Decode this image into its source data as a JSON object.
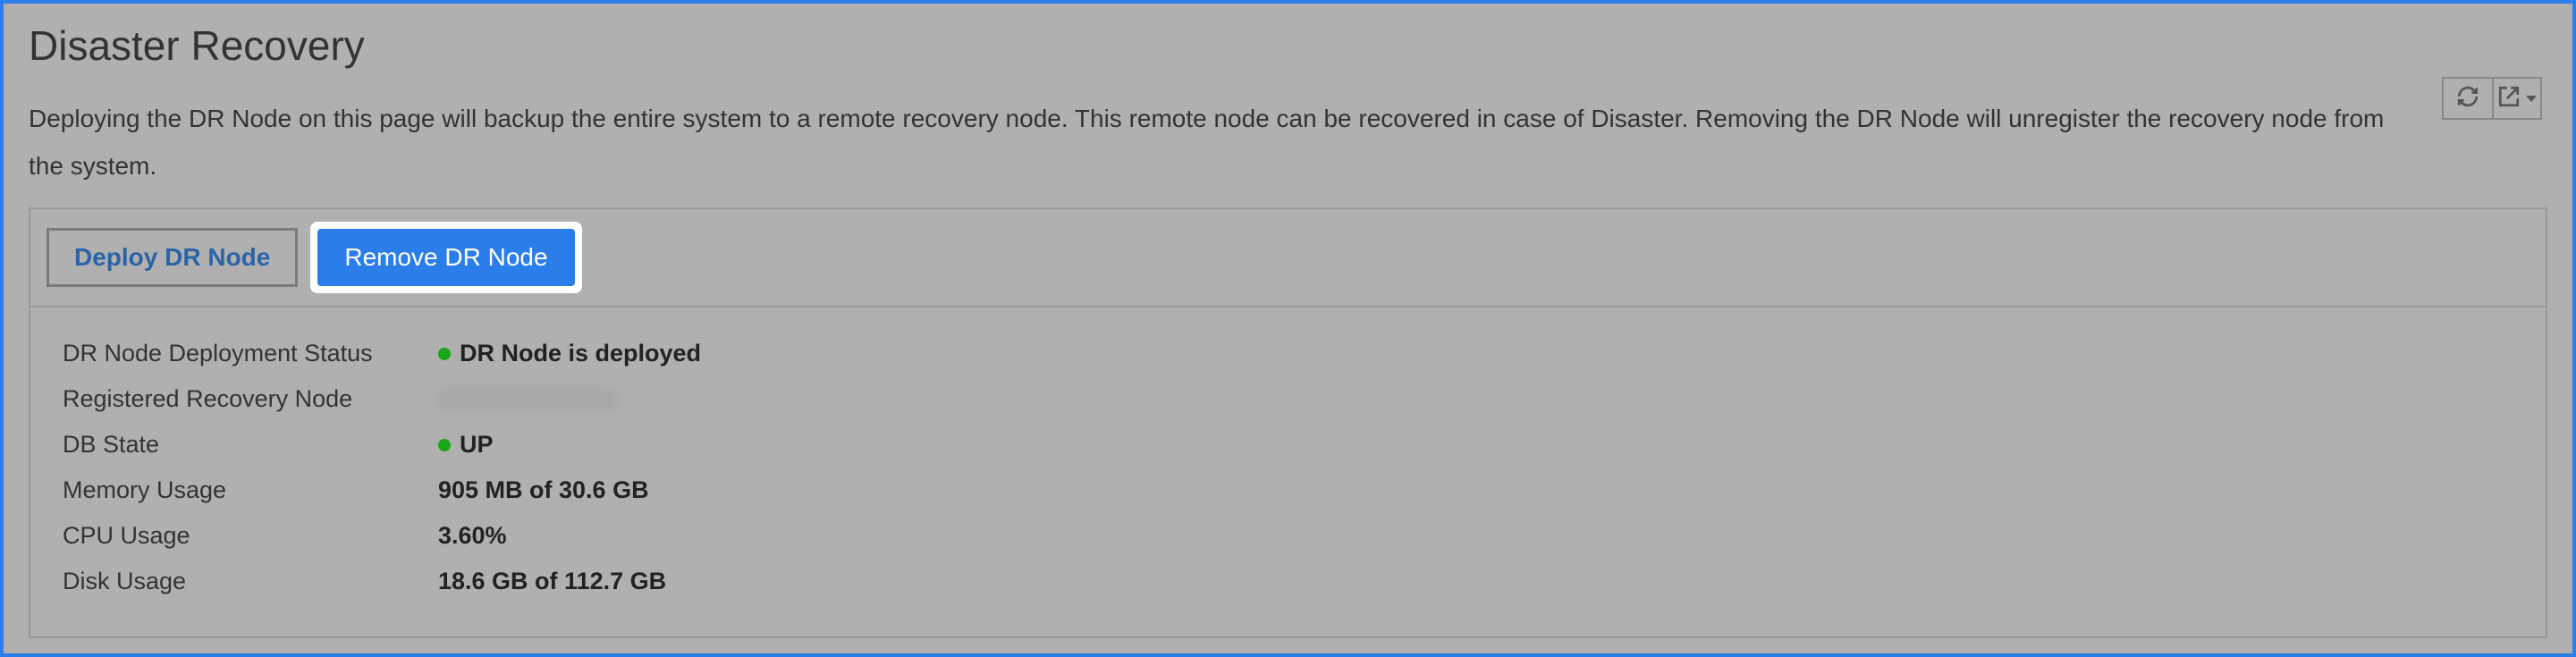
{
  "page": {
    "title": "Disaster Recovery",
    "description": "Deploying the DR Node on this page will backup the entire system to a remote recovery node. This remote node can be recovered in case of Disaster. Removing the DR Node will unregister the recovery node from the system."
  },
  "toolbar": {
    "deploy_label": "Deploy DR Node",
    "remove_label": "Remove DR Node"
  },
  "status": {
    "deployment": {
      "label": "DR Node Deployment Status",
      "value": "DR Node is deployed"
    },
    "recovery_node": {
      "label": "Registered Recovery Node",
      "value": ""
    },
    "db_state": {
      "label": "DB State",
      "value": "UP"
    },
    "memory": {
      "label": "Memory Usage",
      "value": "905 MB of 30.6 GB"
    },
    "cpu": {
      "label": "CPU Usage",
      "value": "3.60%"
    },
    "disk": {
      "label": "Disk Usage",
      "value": "18.6 GB of 112.7 GB"
    }
  }
}
